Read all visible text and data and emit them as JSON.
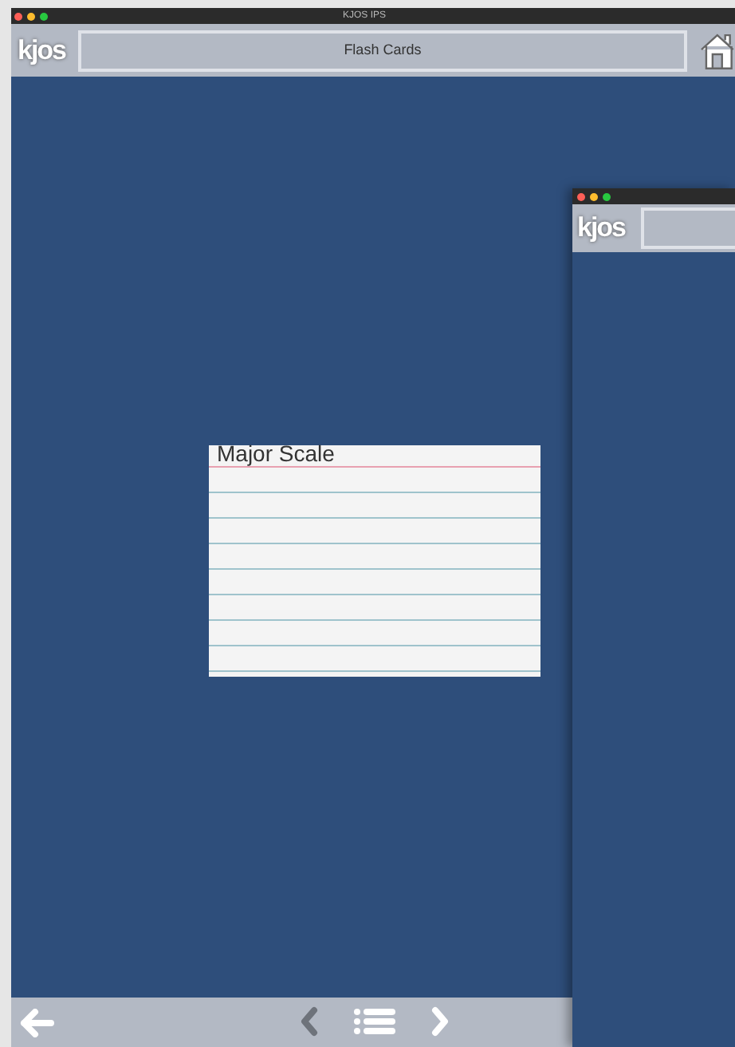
{
  "main_window": {
    "title": "KJOS IPS",
    "logo": "kjos",
    "header_title": "Flash Cards",
    "card": {
      "heading": "Major Scale"
    },
    "nav": {
      "previous": {
        "disabled": true
      },
      "next": {
        "disabled": false
      }
    }
  },
  "second_window": {
    "logo": "kjos"
  }
}
